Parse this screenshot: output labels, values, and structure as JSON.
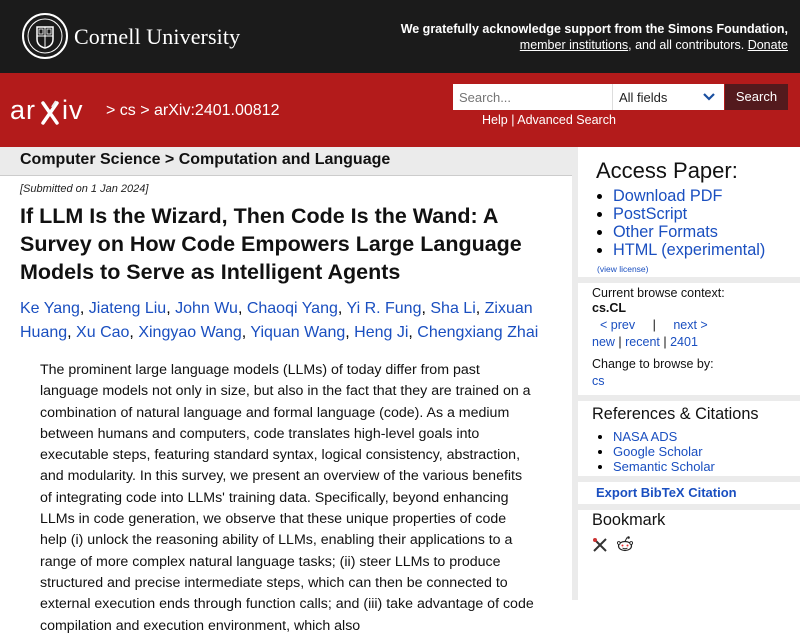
{
  "cornell": {
    "name": "Cornell University",
    "ack_bold": "We gratefully acknowledge support from the Simons Foundation,",
    "member_link": "member institutions",
    "ack_rest": ", and all contributors.",
    "donate_link": "Donate"
  },
  "arxiv_header": {
    "logo": "arXiv",
    "breadcrumb_prefix": "> ",
    "breadcrumb_cs": "cs",
    "breadcrumb_sep": " > ",
    "breadcrumb_id": "arXiv:2401.00812",
    "search_placeholder": "Search...",
    "field_select": "All fields",
    "search_button": "Search",
    "help": "Help",
    "help_sep": " | ",
    "advanced_search": "Advanced Search"
  },
  "subject": "Computer Science > Computation and Language",
  "paper": {
    "submitted": "[Submitted on 1 Jan 2024]",
    "title": "If LLM Is the Wizard, Then Code Is the Wand: A Survey on How Code Empowers Large Language Models to Serve as Intelligent Agents",
    "authors": [
      "Ke Yang",
      "Jiateng Liu",
      "John Wu",
      "Chaoqi Yang",
      "Yi R. Fung",
      "Sha Li",
      "Zixuan Huang",
      "Xu Cao",
      "Xingyao Wang",
      "Yiquan Wang",
      "Heng Ji",
      "Chengxiang Zhai"
    ],
    "abstract": "The prominent large language models (LLMs) of today differ from past language models not only in size, but also in the fact that they are trained on a combination of natural language and formal language (code). As a medium between humans and computers, code translates high-level goals into executable steps, featuring standard syntax, logical consistency, abstraction, and modularity. In this survey, we present an overview of the various benefits of integrating code into LLMs' training data. Specifically, beyond enhancing LLMs in code generation, we observe that these unique properties of code help (i) unlock the reasoning ability of LLMs, enabling their applications to a range of more complex natural language tasks; (ii) steer LLMs to produce structured and precise intermediate steps, which can then be connected to external execution ends through function calls; and (iii) take advantage of code compilation and execution environment, which also"
  },
  "sidebar": {
    "access_heading": "Access Paper:",
    "access_links": [
      "Download PDF",
      "PostScript",
      "Other Formats",
      "HTML (experimental)"
    ],
    "view_license": "(view license)",
    "browse_context_label": "Current browse context:",
    "browse_context": "cs.CL",
    "prev": "< prev",
    "pipe": "|",
    "next": "next >",
    "new": "new",
    "recent": "recent",
    "list_id": "2401",
    "change_browse_label": "Change to browse by:",
    "browse_cs": "cs",
    "refs_heading": "References & Citations",
    "refs_links": [
      "NASA ADS",
      "Google Scholar",
      "Semantic Scholar"
    ],
    "bibtex": "Export BibTeX Citation",
    "bookmark_heading": "Bookmark",
    "bookmark_icons": [
      "bibsonomy-icon",
      "reddit-icon"
    ]
  },
  "colors": {
    "arxiv_red": "#b31b1b",
    "cornell_dark": "#1b1b1b",
    "link_blue": "#1a4fc0",
    "panel_gray": "#ebebeb"
  }
}
